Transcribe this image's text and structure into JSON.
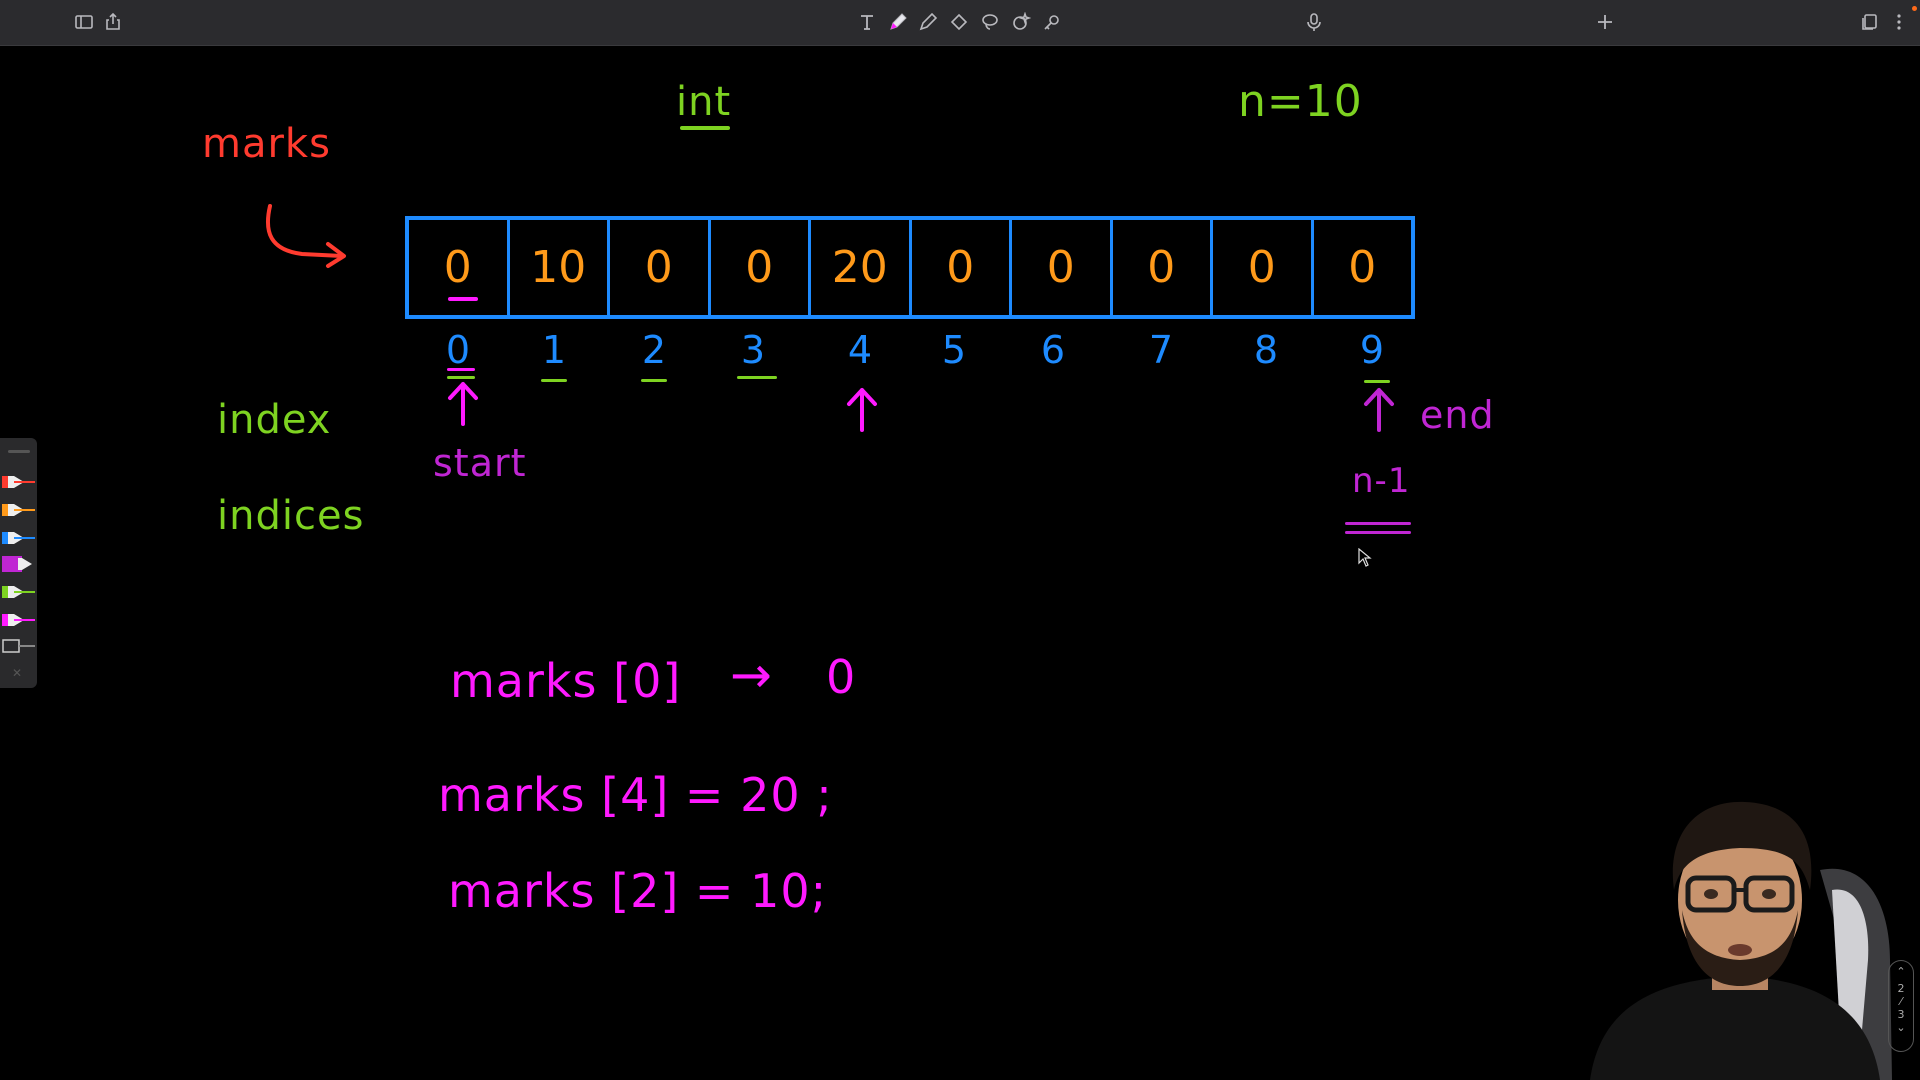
{
  "toolbar": {
    "left": [
      "sidebar-icon",
      "share-icon"
    ],
    "tools": [
      "text-tool-icon",
      "pen-icon",
      "pencil-icon",
      "eraser-icon",
      "lasso-icon",
      "shapes-icon",
      "link-icon"
    ],
    "center": "microphone-icon",
    "add": "plus-icon",
    "right": [
      "pages-icon",
      "more-icon"
    ]
  },
  "whiteboard": {
    "array_name": "marks",
    "type_label": "int",
    "size_label": "n=10",
    "cells": [
      "0",
      "10",
      "0",
      "0",
      "20",
      "0",
      "0",
      "0",
      "0",
      "0"
    ],
    "indices": [
      "0",
      "1",
      "2",
      "3",
      "4",
      "5",
      "6",
      "7",
      "8",
      "9"
    ],
    "index_label": "index",
    "indices_label": "indices",
    "start_label": "start",
    "end_label": "end",
    "last_index_label": "n-1",
    "expr1": "marks [0]",
    "expr1_arrow": "→",
    "expr1_result": "0",
    "expr2": "marks [4]  = 20 ;",
    "expr3": "marks [2]  = 10;"
  },
  "page_indicator": {
    "current": "2",
    "total": "3"
  },
  "colors": {
    "toolbar_bg": "#2b2b2e",
    "canvas_bg": "#000000",
    "red": "#ff3b2f",
    "green": "#7ed321",
    "blue": "#1e8bff",
    "orange": "#ff9a1a",
    "magenta": "#ff1aff",
    "purple": "#c026d3"
  }
}
